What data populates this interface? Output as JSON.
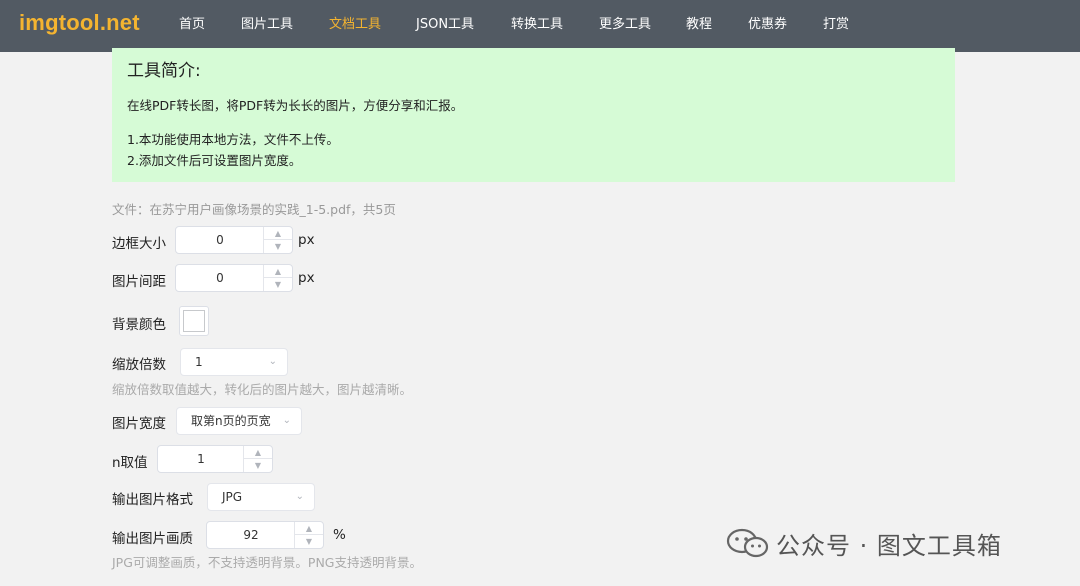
{
  "header": {
    "logo": "imgtool.net",
    "nav": [
      {
        "label": "首页"
      },
      {
        "label": "图片工具"
      },
      {
        "label": "文档工具"
      },
      {
        "label": "JSON工具"
      },
      {
        "label": "转换工具"
      },
      {
        "label": "更多工具"
      },
      {
        "label": "教程"
      },
      {
        "label": "优惠券"
      },
      {
        "label": "打赏"
      }
    ],
    "active_index": 2
  },
  "intro": {
    "title": "工具简介:",
    "desc": "在线PDF转长图，将PDF转为长长的图片，方便分享和汇报。",
    "notes": [
      "1.本功能使用本地方法，文件不上传。",
      "2.添加文件后可设置图片宽度。"
    ]
  },
  "file_info": "文件：在苏宁用户画像场景的实践_1-5.pdf，共5页",
  "form": {
    "border_size": {
      "label": "边框大小",
      "value": "0",
      "unit": "px"
    },
    "image_spacing": {
      "label": "图片间距",
      "value": "0",
      "unit": "px"
    },
    "bg_color": {
      "label": "背景颜色",
      "value": "#ffffff"
    },
    "scale": {
      "label": "缩放倍数",
      "value": "1",
      "hint": "缩放倍数取值越大，转化后的图片越大，图片越清晰。"
    },
    "image_width": {
      "label": "图片宽度",
      "value": "取第n页的页宽"
    },
    "n_value": {
      "label": "n取值",
      "value": "1"
    },
    "output_format": {
      "label": "输出图片格式",
      "value": "JPG"
    },
    "output_quality": {
      "label": "输出图片画质",
      "value": "92",
      "unit": "%",
      "hint": "JPG可调整画质，不支持透明背景。PNG支持透明背景。"
    }
  },
  "watermark": {
    "text": "公众号 · 图文工具箱",
    "icon": "wechat-icon"
  },
  "colors": {
    "header_bg": "#525a63",
    "accent": "#f4b430",
    "intro_bg": "#d6fbd6",
    "page_bg": "#f2f2f2"
  }
}
